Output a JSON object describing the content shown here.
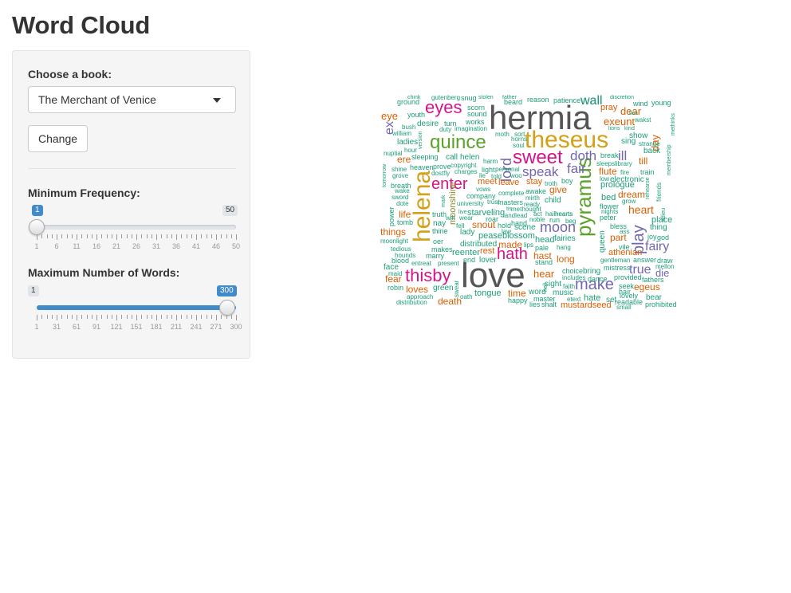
{
  "page": {
    "title": "Word Cloud"
  },
  "sidebar": {
    "book_label": "Choose a book:",
    "book_selected": "The Merchant of Venice",
    "change_label": "Change",
    "min_freq": {
      "label": "Minimum Frequency:",
      "min": 1,
      "max": 50,
      "value": 1,
      "min_label": "1",
      "max_label": "50",
      "value_label": "1",
      "tick_labels": [
        "1",
        "6",
        "11",
        "16",
        "21",
        "26",
        "31",
        "36",
        "41",
        "46",
        "50"
      ]
    },
    "max_words": {
      "label": "Maximum Number of Words:",
      "min": 1,
      "max": 300,
      "value": 300,
      "min_label": "1",
      "max_label": "300",
      "value_label": "300",
      "tick_labels": [
        "1",
        "31",
        "61",
        "91",
        "121",
        "151",
        "181",
        "211",
        "241",
        "271",
        "300"
      ]
    }
  },
  "colors": {
    "gray": "#555555",
    "pink": "#d6148a",
    "green": "#5ba22b",
    "gold": "#d4a017",
    "purple": "#7166b0",
    "orange": "#d95f02",
    "teal": "#1b9e77",
    "olive": "#8a8a2a"
  },
  "wordcloud": {
    "words": [
      {
        "t": "hermia",
        "c": "gray"
      },
      {
        "t": "love",
        "c": "gray"
      },
      {
        "t": "theseus",
        "c": "gold"
      },
      {
        "t": "quince",
        "c": "green"
      },
      {
        "t": "helena",
        "c": "gold"
      },
      {
        "t": "pyramus",
        "c": "green"
      },
      {
        "t": "sweet",
        "c": "pink"
      },
      {
        "t": "eyes",
        "c": "pink"
      },
      {
        "t": "enter",
        "c": "pink"
      },
      {
        "t": "thisby",
        "c": "pink"
      },
      {
        "t": "hath",
        "c": "pink"
      },
      {
        "t": "make",
        "c": "purple"
      },
      {
        "t": "moon",
        "c": "purple"
      },
      {
        "t": "fairy",
        "c": "purple"
      },
      {
        "t": "speak",
        "c": "purple"
      },
      {
        "t": "doth",
        "c": "purple"
      },
      {
        "t": "fair",
        "c": "purple"
      },
      {
        "t": "play",
        "c": "purple"
      },
      {
        "t": "true",
        "c": "purple"
      },
      {
        "t": "lord",
        "c": "purple"
      },
      {
        "t": "ill",
        "c": "purple"
      },
      {
        "t": "wall",
        "c": "purple"
      },
      {
        "t": "ex",
        "c": "purple"
      },
      {
        "t": "heart",
        "c": "orange"
      },
      {
        "t": "exeunt",
        "c": "orange"
      },
      {
        "t": "dear",
        "c": "orange"
      },
      {
        "t": "day",
        "c": "orange"
      },
      {
        "t": "eye",
        "c": "orange"
      },
      {
        "t": "hear",
        "c": "orange"
      },
      {
        "t": "thisbys",
        "c": "teal"
      },
      {
        "t": "fear",
        "c": "orange"
      },
      {
        "t": "loves",
        "c": "orange"
      },
      {
        "t": "death",
        "c": "orange"
      },
      {
        "t": "egeus",
        "c": "orange"
      },
      {
        "t": "long",
        "c": "orange"
      },
      {
        "t": "give",
        "c": "orange"
      },
      {
        "t": "hast",
        "c": "orange"
      },
      {
        "t": "stay",
        "c": "orange"
      },
      {
        "t": "flute",
        "c": "orange"
      },
      {
        "t": "athenian",
        "c": "orange"
      },
      {
        "t": "pray",
        "c": "orange"
      },
      {
        "t": "things",
        "c": "orange"
      },
      {
        "t": "life",
        "c": "orange"
      },
      {
        "t": "part",
        "c": "orange"
      },
      {
        "t": "dream",
        "c": "orange"
      },
      {
        "t": "time",
        "c": "orange"
      },
      {
        "t": "made",
        "c": "orange"
      },
      {
        "t": "snout",
        "c": "orange"
      },
      {
        "t": "rest",
        "c": "orange"
      },
      {
        "t": "mustardseed",
        "c": "orange"
      },
      {
        "t": "ere",
        "c": "orange"
      },
      {
        "t": "till",
        "c": "orange"
      },
      {
        "t": "leave",
        "c": "orange"
      },
      {
        "t": "meet",
        "c": "orange"
      },
      {
        "t": "moonshine",
        "c": "olive"
      },
      {
        "t": "queen",
        "c": "teal"
      },
      {
        "t": "peaseblossom",
        "c": "teal"
      },
      {
        "t": "scene",
        "c": "teal"
      },
      {
        "t": "head",
        "c": "teal"
      },
      {
        "t": "fairies",
        "c": "teal"
      },
      {
        "t": "child",
        "c": "teal"
      },
      {
        "t": "prologue",
        "c": "teal"
      },
      {
        "t": "bed",
        "c": "teal"
      },
      {
        "t": "place",
        "c": "teal"
      },
      {
        "t": "thing",
        "c": "teal"
      },
      {
        "t": "bear",
        "c": "teal"
      },
      {
        "t": "music",
        "c": "teal"
      },
      {
        "t": "word",
        "c": "teal"
      },
      {
        "t": "tongue",
        "c": "teal"
      },
      {
        "t": "green",
        "c": "teal"
      },
      {
        "t": "lover",
        "c": "teal"
      },
      {
        "t": "reenter",
        "c": "teal"
      },
      {
        "t": "lady",
        "c": "teal"
      },
      {
        "t": "starveling",
        "c": "teal"
      },
      {
        "t": "helen",
        "c": "teal"
      },
      {
        "t": "call",
        "c": "teal"
      },
      {
        "t": "sleeping",
        "c": "teal"
      },
      {
        "t": "desire",
        "c": "teal"
      },
      {
        "t": "ladies",
        "c": "teal"
      },
      {
        "t": "youth",
        "c": "teal"
      },
      {
        "t": "ground",
        "c": "teal"
      },
      {
        "t": "scorn",
        "c": "teal"
      },
      {
        "t": "sound",
        "c": "teal"
      },
      {
        "t": "works",
        "c": "teal"
      },
      {
        "t": "beard",
        "c": "teal"
      },
      {
        "t": "reason",
        "c": "teal"
      },
      {
        "t": "patience",
        "c": "teal"
      },
      {
        "t": "wind",
        "c": "teal"
      },
      {
        "t": "young",
        "c": "teal"
      },
      {
        "t": "show",
        "c": "teal"
      },
      {
        "t": "back",
        "c": "teal"
      },
      {
        "t": "sing",
        "c": "teal"
      },
      {
        "t": "strange",
        "c": "teal"
      },
      {
        "t": "electronic",
        "c": "teal"
      },
      {
        "t": "train",
        "c": "teal"
      },
      {
        "t": "answer",
        "c": "teal"
      },
      {
        "t": "draw",
        "c": "teal"
      },
      {
        "t": "fathers",
        "c": "teal"
      },
      {
        "t": "vile",
        "c": "teal"
      },
      {
        "t": "bring",
        "c": "teal"
      },
      {
        "t": "dance",
        "c": "teal"
      },
      {
        "t": "hate",
        "c": "teal"
      },
      {
        "t": "set",
        "c": "teal"
      },
      {
        "t": "lovely",
        "c": "teal"
      },
      {
        "t": "readable",
        "c": "teal"
      },
      {
        "t": "prohibited",
        "c": "teal"
      },
      {
        "t": "small",
        "c": "teal"
      },
      {
        "t": "master",
        "c": "teal"
      },
      {
        "t": "happy",
        "c": "teal"
      },
      {
        "t": "lies",
        "c": "teal"
      },
      {
        "t": "shalt",
        "c": "teal"
      },
      {
        "t": "sight",
        "c": "teal"
      },
      {
        "t": "choice",
        "c": "teal"
      },
      {
        "t": "includes",
        "c": "teal"
      },
      {
        "t": "mistress",
        "c": "teal"
      },
      {
        "t": "gentleman",
        "c": "teal"
      },
      {
        "t": "provided",
        "c": "teal"
      },
      {
        "t": "seek",
        "c": "teal"
      },
      {
        "t": "hair",
        "c": "teal"
      },
      {
        "t": "joy",
        "c": "teal"
      },
      {
        "t": "god",
        "c": "teal"
      },
      {
        "t": "mellon",
        "c": "teal"
      },
      {
        "t": "die",
        "c": "purple"
      },
      {
        "t": "blood",
        "c": "teal"
      },
      {
        "t": "face",
        "c": "teal"
      },
      {
        "t": "maid",
        "c": "teal"
      },
      {
        "t": "robin",
        "c": "teal"
      },
      {
        "t": "approach",
        "c": "teal"
      },
      {
        "t": "distribution",
        "c": "teal"
      },
      {
        "t": "tedious",
        "c": "teal"
      },
      {
        "t": "hounds",
        "c": "teal"
      },
      {
        "t": "moonlight",
        "c": "teal"
      },
      {
        "t": "entreat",
        "c": "teal"
      },
      {
        "t": "present",
        "c": "teal"
      },
      {
        "t": "marry",
        "c": "teal"
      },
      {
        "t": "makes",
        "c": "teal"
      },
      {
        "t": "oer",
        "c": "teal"
      },
      {
        "t": "end",
        "c": "teal"
      },
      {
        "t": "distributed",
        "c": "teal"
      },
      {
        "t": "power",
        "c": "teal"
      },
      {
        "t": "tomb",
        "c": "teal"
      },
      {
        "t": "nay",
        "c": "teal"
      },
      {
        "t": "thine",
        "c": "teal"
      },
      {
        "t": "truth",
        "c": "teal"
      },
      {
        "t": "wall",
        "c": "teal"
      },
      {
        "t": "breath",
        "c": "teal"
      },
      {
        "t": "wake",
        "c": "teal"
      },
      {
        "t": "sword",
        "c": "teal"
      },
      {
        "t": "dote",
        "c": "teal"
      },
      {
        "t": "grove",
        "c": "teal"
      },
      {
        "t": "shine",
        "c": "teal"
      },
      {
        "t": "heaven",
        "c": "teal"
      },
      {
        "t": "nuptial",
        "c": "teal"
      },
      {
        "t": "hour",
        "c": "teal"
      },
      {
        "t": "william",
        "c": "teal"
      },
      {
        "t": "bush",
        "c": "teal"
      },
      {
        "t": "version",
        "c": "teal"
      },
      {
        "t": "turn",
        "c": "teal"
      },
      {
        "t": "duty",
        "c": "teal"
      },
      {
        "t": "imagination",
        "c": "teal"
      },
      {
        "t": "moth",
        "c": "teal"
      },
      {
        "t": "sort",
        "c": "teal"
      },
      {
        "t": "horns",
        "c": "teal"
      },
      {
        "t": "soul",
        "c": "teal"
      },
      {
        "t": "harm",
        "c": "teal"
      },
      {
        "t": "light",
        "c": "teal"
      },
      {
        "t": "personal",
        "c": "teal"
      },
      {
        "t": "woo",
        "c": "teal"
      },
      {
        "t": "told",
        "c": "teal"
      },
      {
        "t": "lie",
        "c": "teal"
      },
      {
        "t": "charges",
        "c": "teal"
      },
      {
        "t": "copyright",
        "c": "teal"
      },
      {
        "t": "prove",
        "c": "teal"
      },
      {
        "t": "dostfly",
        "c": "teal"
      },
      {
        "t": "vows",
        "c": "teal"
      },
      {
        "t": "company",
        "c": "teal"
      },
      {
        "t": "complete",
        "c": "teal"
      },
      {
        "t": "awake",
        "c": "teal"
      },
      {
        "t": "troth",
        "c": "teal"
      },
      {
        "t": "boy",
        "c": "teal"
      },
      {
        "t": "mirth",
        "c": "teal"
      },
      {
        "t": "ready",
        "c": "teal"
      },
      {
        "t": "masters",
        "c": "teal"
      },
      {
        "t": "university",
        "c": "teal"
      },
      {
        "t": "trust",
        "c": "teal"
      },
      {
        "t": "methought",
        "c": "teal"
      },
      {
        "t": "hail",
        "c": "teal"
      },
      {
        "t": "hearts",
        "c": "teal"
      },
      {
        "t": "act",
        "c": "teal"
      },
      {
        "t": "landlead",
        "c": "teal"
      },
      {
        "t": "hold",
        "c": "teal"
      },
      {
        "t": "law",
        "c": "teal"
      },
      {
        "t": "roar",
        "c": "teal"
      },
      {
        "t": "noble",
        "c": "teal"
      },
      {
        "t": "run",
        "c": "teal"
      },
      {
        "t": "beg",
        "c": "teal"
      },
      {
        "t": "hand",
        "c": "teal"
      },
      {
        "t": "lips",
        "c": "teal"
      },
      {
        "t": "pale",
        "c": "teal"
      },
      {
        "t": "hang",
        "c": "teal"
      },
      {
        "t": "stand",
        "c": "teal"
      },
      {
        "t": "faith",
        "c": "teal"
      },
      {
        "t": "etext",
        "c": "teal"
      },
      {
        "t": "grow",
        "c": "teal"
      },
      {
        "t": "nights",
        "c": "teal"
      },
      {
        "t": "flower",
        "c": "teal"
      },
      {
        "t": "peter",
        "c": "teal"
      },
      {
        "t": "bless",
        "c": "teal"
      },
      {
        "t": "ass",
        "c": "teal"
      },
      {
        "t": "low",
        "c": "teal"
      },
      {
        "t": "break",
        "c": "teal"
      },
      {
        "t": "sleeps",
        "c": "teal"
      },
      {
        "t": "library",
        "c": "teal"
      },
      {
        "t": "fire",
        "c": "teal"
      },
      {
        "t": "lions",
        "c": "teal"
      },
      {
        "t": "kind",
        "c": "teal"
      },
      {
        "t": "wakst",
        "c": "teal"
      },
      {
        "t": "methinks",
        "c": "teal"
      },
      {
        "t": "friends",
        "c": "teal"
      },
      {
        "t": "adieu",
        "c": "teal"
      },
      {
        "t": "rehearse",
        "c": "teal"
      },
      {
        "t": "membership",
        "c": "teal"
      },
      {
        "t": "tomorrow",
        "c": "teal"
      },
      {
        "t": "gutenberg",
        "c": "teal"
      },
      {
        "t": "snug",
        "c": "teal"
      },
      {
        "t": "stolen",
        "c": "teal"
      },
      {
        "t": "father",
        "c": "teal"
      },
      {
        "t": "discretion",
        "c": "teal"
      },
      {
        "t": "chink",
        "c": "teal"
      },
      {
        "t": "oath",
        "c": "teal"
      },
      {
        "t": "swear",
        "c": "teal"
      },
      {
        "t": "lion",
        "c": "teal"
      },
      {
        "t": "hearts",
        "c": "teal"
      },
      {
        "t": "tis",
        "c": "teal"
      },
      {
        "t": "wilt",
        "c": "teal"
      },
      {
        "t": "wear",
        "c": "teal"
      },
      {
        "t": "mark",
        "c": "teal"
      },
      {
        "t": "live",
        "c": "teal"
      },
      {
        "t": "fell",
        "c": "teal"
      },
      {
        "t": "hell",
        "c": "teal"
      }
    ]
  }
}
